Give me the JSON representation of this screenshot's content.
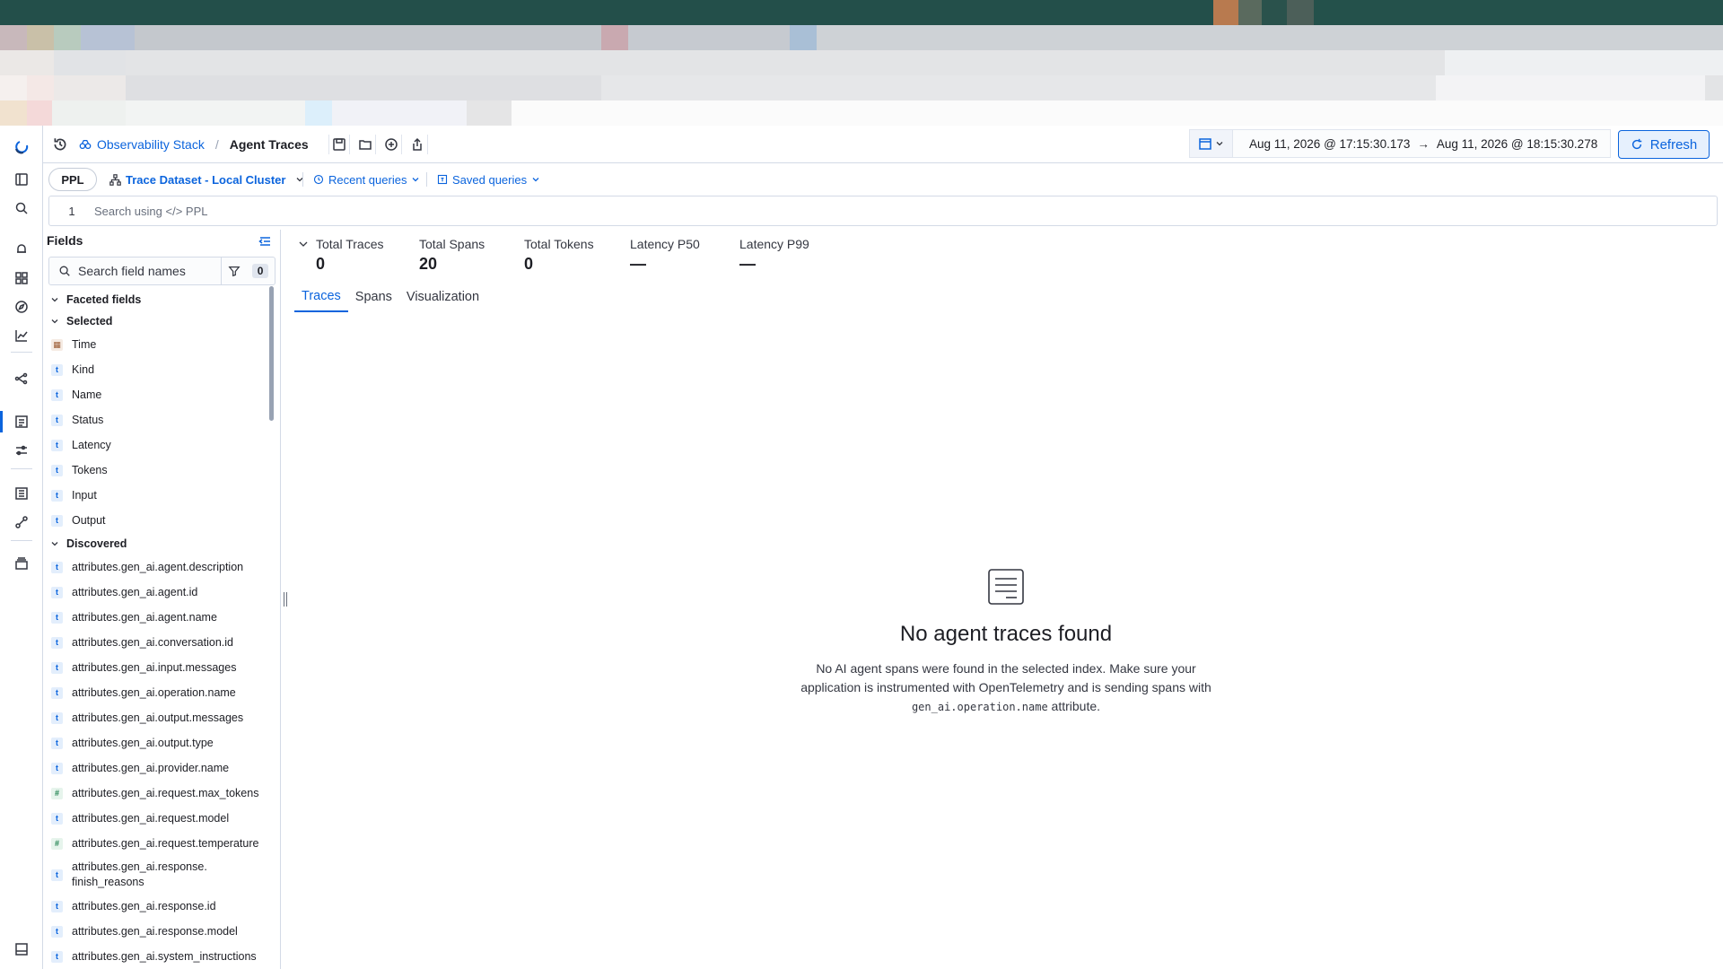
{
  "theme": {
    "accent": "#0b64dd",
    "border": "#d3dae6"
  },
  "header": {
    "breadcrumb_root": "Observability Stack",
    "breadcrumb_separator": "/",
    "breadcrumb_current": "Agent Traces",
    "date_start": "Aug 11, 2026 @ 17:15:30.173",
    "date_arrow": "→",
    "date_end": "Aug 11, 2026 @ 18:15:30.278",
    "refresh_label": "Refresh"
  },
  "query": {
    "language": "PPL",
    "dataset": "Trace Dataset - Local Cluster",
    "recent_queries": "Recent queries",
    "saved_queries": "Saved queries",
    "line_number": "1",
    "placeholder": "Search using </> PPL"
  },
  "fields_panel": {
    "title": "Fields",
    "search_placeholder": "Search field names",
    "filter_count": "0",
    "faceted_label": "Faceted fields",
    "selected_label": "Selected",
    "selected": [
      {
        "name": "Time",
        "type": "date",
        "icon": "calendar"
      },
      {
        "name": "Kind",
        "type": "t"
      },
      {
        "name": "Name",
        "type": "t"
      },
      {
        "name": "Status",
        "type": "t"
      },
      {
        "name": "Latency",
        "type": "t"
      },
      {
        "name": "Tokens",
        "type": "t"
      },
      {
        "name": "Input",
        "type": "t"
      },
      {
        "name": "Output",
        "type": "t"
      }
    ],
    "discovered_label": "Discovered",
    "discovered": [
      {
        "name": "attributes.gen_ai.agent.description",
        "type": "t"
      },
      {
        "name": "attributes.gen_ai.agent.id",
        "type": "t"
      },
      {
        "name": "attributes.gen_ai.agent.name",
        "type": "t"
      },
      {
        "name": "attributes.gen_ai.conversation.id",
        "type": "t"
      },
      {
        "name": "attributes.gen_ai.input.messages",
        "type": "t"
      },
      {
        "name": "attributes.gen_ai.operation.name",
        "type": "t"
      },
      {
        "name": "attributes.gen_ai.output.messages",
        "type": "t"
      },
      {
        "name": "attributes.gen_ai.output.type",
        "type": "t"
      },
      {
        "name": "attributes.gen_ai.provider.name",
        "type": "t"
      },
      {
        "name": "attributes.gen_ai.request.max_tokens",
        "type": "#"
      },
      {
        "name": "attributes.gen_ai.request.model",
        "type": "t"
      },
      {
        "name": "attributes.gen_ai.request.temperature",
        "type": "#"
      },
      {
        "name": "attributes.gen_ai.response.",
        "name2": "finish_reasons",
        "type": "t"
      },
      {
        "name": "attributes.gen_ai.response.id",
        "type": "t"
      },
      {
        "name": "attributes.gen_ai.response.model",
        "type": "t"
      },
      {
        "name": "attributes.gen_ai.system_instructions",
        "type": "t"
      }
    ]
  },
  "stats": [
    {
      "label": "Total Traces",
      "value": "0"
    },
    {
      "label": "Total Spans",
      "value": "20"
    },
    {
      "label": "Total Tokens",
      "value": "0"
    },
    {
      "label": "Latency P50",
      "value": "—"
    },
    {
      "label": "Latency P99",
      "value": "—"
    }
  ],
  "tabs": [
    "Traces",
    "Spans",
    "Visualization"
  ],
  "empty_state": {
    "title": "No agent traces found",
    "body_1": "No AI agent spans were found in the selected index. Make sure your application is instrumented with OpenTelemetry and is sending spans with ",
    "body_code": "gen_ai.operation.name",
    "body_2": " attribute."
  }
}
